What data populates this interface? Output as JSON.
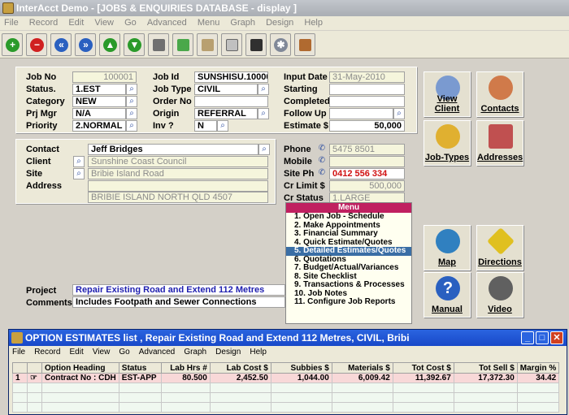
{
  "app": {
    "title": "InterAcct Demo - [JOBS & ENQUIRIES DATABASE - display ]"
  },
  "menubar": [
    "File",
    "Record",
    "Edit",
    "View",
    "Go",
    "Advanced",
    "Menu",
    "Graph",
    "Design",
    "Help"
  ],
  "toolbar_icons": [
    "add-icon",
    "delete-icon",
    "first-record-icon",
    "last-record-icon",
    "previous-icon",
    "next-icon",
    "print-icon",
    "export-icon",
    "search-icon",
    "calculator-icon",
    "screen-icon",
    "settings-icon",
    "exit-door-icon"
  ],
  "job": {
    "job_no_label": "Job No",
    "job_no": "100001",
    "status_label": "Status.",
    "status": "1.EST",
    "category_label": "Category",
    "category": "NEW",
    "prj_mgr_label": "Prj Mgr",
    "prj_mgr": "N/A",
    "priority_label": "Priority",
    "priority": "2.NORMAL",
    "job_id_label": "Job Id",
    "job_id": "SUNSHISU.10000",
    "job_type_label": "Job Type",
    "job_type": "CIVIL",
    "order_no_label": "Order No",
    "order_no": "",
    "origin_label": "Origin",
    "origin": "REFERRAL",
    "inv_label": "Inv ?",
    "inv": "N",
    "input_date_label": "Input Date",
    "input_date": "31-May-2010",
    "starting_label": "Starting",
    "starting": "",
    "completed_label": "Completed",
    "completed": "",
    "follow_up_label": "Follow Up",
    "follow_up": "",
    "estimate_label": "Estimate $",
    "estimate": "50,000"
  },
  "contact": {
    "contact_label": "Contact",
    "contact": "Jeff Bridges",
    "client_label": "Client",
    "client": "Sunshine Coast Council",
    "site_label": "Site",
    "site": "Bribie Island Road",
    "address_label": "Address",
    "address1": "",
    "address2": "BRIBIE ISLAND NORTH QLD 4507",
    "phone_label": "Phone",
    "phone": "5475 8501",
    "mobile_label": "Mobile",
    "mobile": "",
    "site_ph_label": "Site Ph",
    "site_ph": "0412 556 334",
    "cr_limit_label": "Cr Limit $",
    "cr_limit": "500,000",
    "cr_status_label": "Cr Status",
    "cr_status": "1.LARGE"
  },
  "project": {
    "project_label": "Project",
    "project": "Repair Existing Road and Extend 112 Metres",
    "comments_label": "Comments",
    "comments": "Includes Footpath and Sewer Connections"
  },
  "side_buttons": {
    "view_client": "View Client",
    "contacts": "Contacts",
    "job_types": "Job-Types",
    "addresses": "Addresses",
    "map": "Map",
    "directions": "Directions",
    "manual": "Manual",
    "video": "Video"
  },
  "menu": {
    "title": "Menu",
    "items": [
      "1. Open Job - Schedule",
      "2. Make Appointments",
      "3. Financial Summary",
      "4. Quick Estimate/Quotes",
      "5. Detailed Estimates/Quotes",
      "6. Quotations",
      "7. Budget/Actual/Variances",
      "8. Site Checklist",
      "9. Transactions & Processes",
      "10. Job Notes",
      "11. Configure Job Reports"
    ],
    "selected_index": 4
  },
  "estimates_window": {
    "title": "OPTION ESTIMATES list , Repair Existing Road and Extend 112 Metres, CIVIL, Bribi",
    "menubar": [
      "File",
      "Record",
      "Edit",
      "View",
      "Go",
      "Advanced",
      "Graph",
      "Design",
      "Help"
    ],
    "columns": [
      "Option Heading",
      "Status",
      "Lab Hrs #",
      "Lab Cost $",
      "Subbies $",
      "Materials $",
      "Tot Cost $",
      "Tot Sell $",
      "Margin %"
    ],
    "rows": [
      {
        "num": "1",
        "heading": "Contract No : CDH",
        "status": "EST-APP",
        "lab_hrs": "80.500",
        "lab_cost": "2,452.50",
        "subbies": "1,044.00",
        "materials": "6,009.42",
        "tot_cost": "11,392.67",
        "tot_sell": "17,372.30",
        "margin": "34.42"
      }
    ]
  }
}
